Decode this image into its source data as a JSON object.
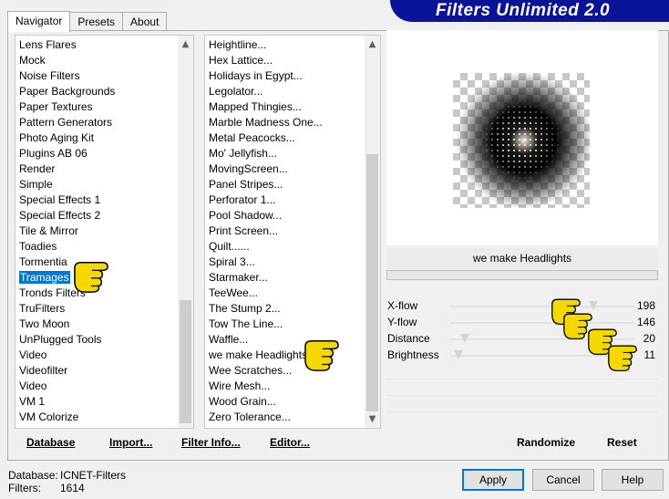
{
  "tabs": [
    {
      "label": "Navigator",
      "active": true
    },
    {
      "label": "Presets",
      "active": false
    },
    {
      "label": "About",
      "active": false
    }
  ],
  "app_title": "Filters Unlimited 2.0",
  "categories": {
    "items": [
      "Lens Flares",
      "Mock",
      "Noise Filters",
      "Paper Backgrounds",
      "Paper Textures",
      "Pattern Generators",
      "Photo Aging Kit",
      "Plugins AB 06",
      "Render",
      "Simple",
      "Special Effects 1",
      "Special Effects 2",
      "Tile & Mirror",
      "Toadies",
      "Tormentia",
      "Tramages",
      "Tronds Filters",
      "TruFilters",
      "Two Moon",
      "UnPlugged Tools",
      "Video",
      "Videofilter",
      "Video",
      "VM 1",
      "VM Colorize"
    ],
    "selected": "Tramages"
  },
  "filters": {
    "items": [
      "Heightline...",
      "Hex Lattice...",
      "Holidays in Egypt...",
      "Legolator...",
      "Mapped Thingies...",
      "Marble Madness One...",
      "Metal Peacocks...",
      "Mo' Jellyfish...",
      "MovingScreen...",
      "Panel Stripes...",
      "Perforator 1...",
      "Pool Shadow...",
      "Print Screen...",
      "Quilt......",
      "Spiral 3...",
      "Starmaker...",
      "TeeWee...",
      "The Stump 2...",
      "Tow The Line...",
      "Waffle...",
      "we make Headlights",
      "Wee Scratches...",
      "Wire Mesh...",
      "Wood Grain...",
      "Zero Tolerance..."
    ]
  },
  "scroll_arrows": {
    "up": "▲",
    "down": "▼"
  },
  "bottom_buttons": {
    "database": "Database",
    "import": "Import...",
    "filter_info": "Filter Info...",
    "editor": "Editor...",
    "randomize": "Randomize",
    "reset": "Reset"
  },
  "selected_filter_name": "we make Headlights",
  "progress_fraction": 0.0,
  "parameters": [
    {
      "label": "X-flow",
      "value": "198",
      "fraction": 0.776
    },
    {
      "label": "Y-flow",
      "value": "146",
      "fraction": 0.573
    },
    {
      "label": "Distance",
      "value": "20",
      "fraction": 0.078
    },
    {
      "label": "Brightness",
      "value": "11",
      "fraction": 0.043
    }
  ],
  "footer": {
    "database_label": "Database:",
    "database_value": "ICNET-Filters",
    "filters_label": "Filters:",
    "filters_value": "1614"
  },
  "dialog_buttons": {
    "apply": "Apply",
    "cancel": "Cancel",
    "help": "Help"
  },
  "colors": {
    "title_bar": "#0a1496",
    "selection": "#0078d7",
    "pointer_hand": "#f5d800"
  }
}
